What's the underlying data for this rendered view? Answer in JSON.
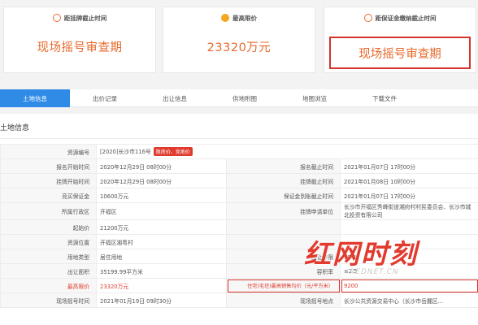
{
  "cards": [
    {
      "label": "距挂牌截止时间",
      "value": "现场摇号审查期",
      "icon": "clock-icon",
      "color": "#e7692c"
    },
    {
      "label": "最高限价",
      "value": "23320万元",
      "icon": "money-icon",
      "color": "#f5a623"
    },
    {
      "label": "距保证金缴纳截止时间",
      "value": "现场摇号审查期",
      "icon": "clock-icon",
      "color": "#e7692c"
    }
  ],
  "tabs": [
    "土地信息",
    "出价记录",
    "出让信息",
    "供地附图",
    "地图浏览",
    "下载文件"
  ],
  "section": {
    "title": "土地信息"
  },
  "rows": {
    "r1": {
      "l1": "资源编号",
      "v1": "[2020]长沙市116号",
      "tag": "限房价、竞地价"
    },
    "r2": {
      "l1": "报名开始时间",
      "v1": "2020年12月29日 08时00分",
      "l2": "报名截止时间",
      "v2": "2021年01月07日 17时00分"
    },
    "r3": {
      "l1": "挂牌开始时间",
      "v1": "2020年12月29日 08时00分",
      "l2": "挂牌截止时间",
      "v2": "2021年01月08日 10时00分"
    },
    "r4": {
      "l1": "竞买保证金",
      "v1": "10600万元",
      "l2": "保证金到账截止时间",
      "v2": "2021年01月07日 17时00分"
    },
    "r5": {
      "l1": "所属行政区",
      "v1": "开福区",
      "l2": "挂牌申请单位",
      "v2": "长沙市开福区秀峰街道湘府村村民委员会、长沙市城北投资有限公司"
    },
    "r6": {
      "l1": "起始价",
      "v1": "21200万元"
    },
    "r7": {
      "l1": "资源位置",
      "v1": "开福区湘粤村"
    },
    "r8": {
      "l1": "用地类型",
      "v1": "居住用地",
      "l2": "出让年限",
      "v2": "70年"
    },
    "r9": {
      "l1": "出让面积",
      "v1": "35199.99平方米",
      "l2": "容积率",
      "v2": "≤2.5"
    },
    "r10": {
      "l1": "最高限价",
      "v1": "23320万元",
      "l2": "住宅(毛坯)最高销售均价（元/平方米）",
      "v2": "9200"
    },
    "r11": {
      "l1": "现场摇号时间",
      "v1": "2021年01月19日 09时30分",
      "l2": "现场摇号地点",
      "v2": "长沙公共资源交易中心（长沙市岳麓区..."
    }
  },
  "watermark": {
    "main": "红网时刻",
    "sub": "REDNET.CN"
  }
}
